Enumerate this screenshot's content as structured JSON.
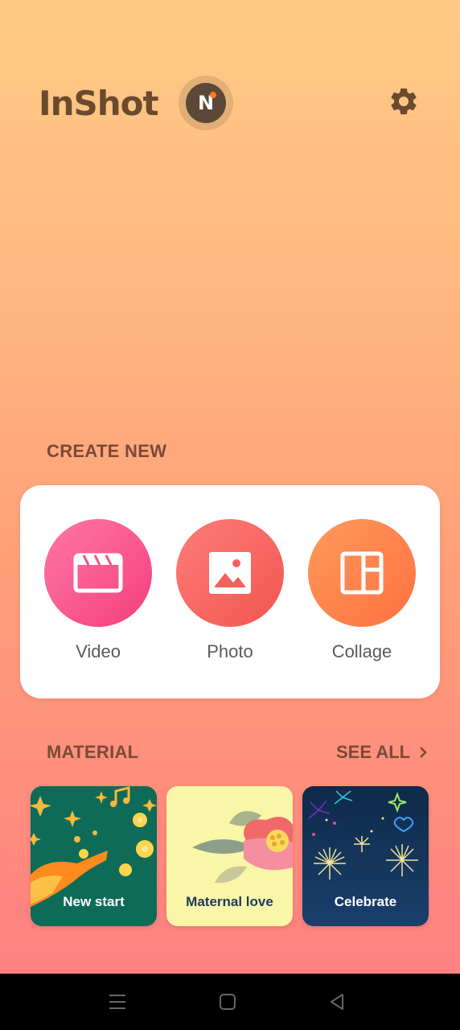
{
  "header": {
    "app_name": "InShot",
    "badge_letter": "N",
    "settings_icon": "gear-icon"
  },
  "create": {
    "section_label": "CREATE NEW",
    "tools": [
      {
        "label": "Video",
        "icon": "clapperboard-icon",
        "color": "#F6508A"
      },
      {
        "label": "Photo",
        "icon": "image-icon",
        "color": "#F4605A"
      },
      {
        "label": "Collage",
        "icon": "collage-icon",
        "color": "#FF7A48"
      }
    ]
  },
  "material": {
    "section_label": "MATERIAL",
    "see_all_label": "SEE ALL",
    "items": [
      {
        "title": "New start",
        "background": "#0E6B57"
      },
      {
        "title": "Maternal love",
        "background": "#FAF6A8"
      },
      {
        "title": "Celebrate",
        "background": "#15365E"
      }
    ]
  },
  "navigation": {
    "buttons": [
      "menu-icon",
      "home-icon",
      "back-icon"
    ]
  },
  "colors": {
    "gradient_top": "#FFCB86",
    "gradient_bottom": "#FF8182",
    "label_color": "#7A4A3A"
  }
}
